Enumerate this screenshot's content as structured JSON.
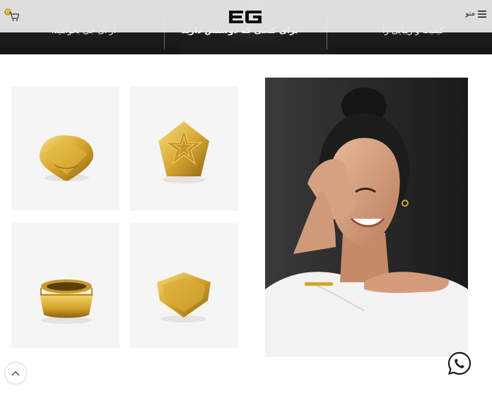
{
  "header": {
    "logo_text": "EG",
    "menu_label": "منو",
    "menu_icon": "hamburger-icon",
    "cart_count": "0",
    "cart_icon": "cart-icon"
  },
  "hero": {
    "texts": [
      "کیفیت و زیبایی را",
      "برای کسی که دوستش دارید",
      "از ای جی بخواهید."
    ]
  },
  "products": [
    {
      "name": "Rounded diamond signet ring",
      "icon": "ring-image"
    },
    {
      "name": "Star pentagon signet ring",
      "icon": "ring-image"
    },
    {
      "name": "Engraved band signet ring",
      "icon": "ring-image"
    },
    {
      "name": "Shield signet ring",
      "icon": "ring-image"
    }
  ],
  "colors": {
    "gold": "#d4a52a",
    "gold_light": "#f3d36b",
    "hero_bg": "#1b1b1b",
    "tile_bg": "#f6f5f5"
  },
  "floating": {
    "scroll_top_icon": "chevron-up-icon",
    "chat_icon": "whatsapp-icon"
  }
}
